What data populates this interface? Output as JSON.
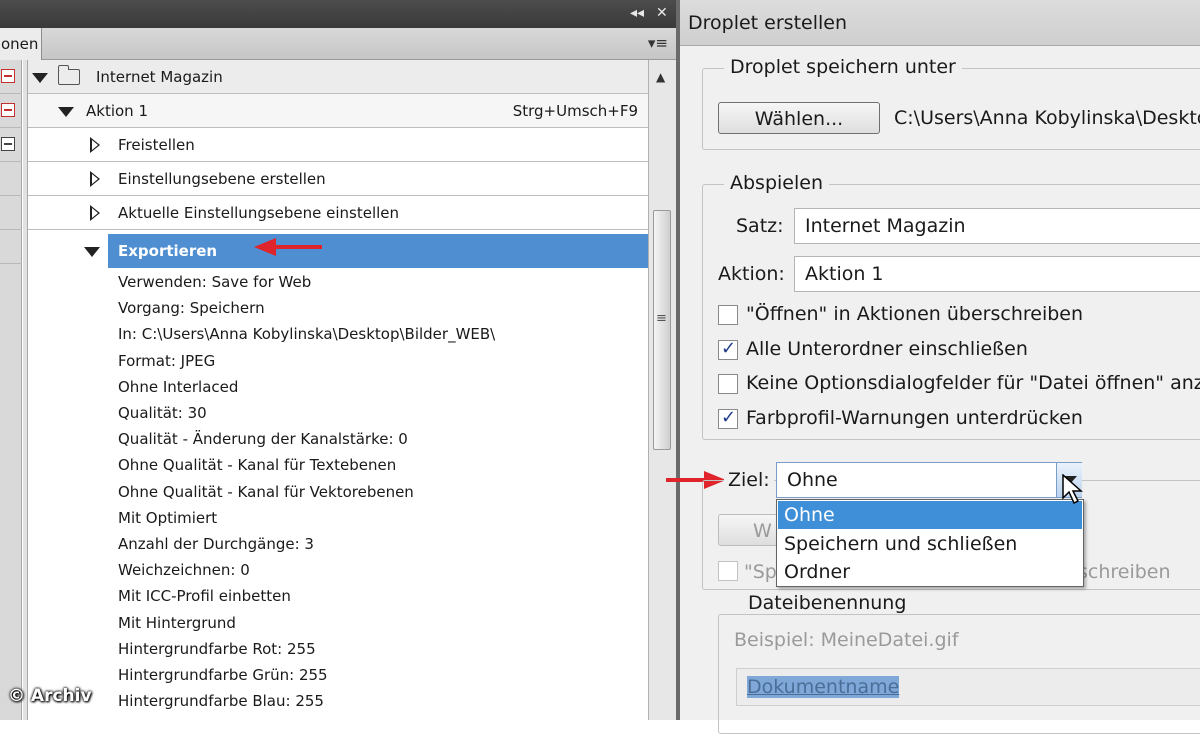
{
  "actions_panel": {
    "tab_label": "onen",
    "set": {
      "name": "Internet Magazin"
    },
    "action": {
      "name": "Aktion 1",
      "shortcut": "Strg+Umsch+F9"
    },
    "steps": [
      {
        "label": "Freistellen"
      },
      {
        "label": "Einstellungsebene erstellen"
      },
      {
        "label": "Aktuelle Einstellungsebene einstellen"
      },
      {
        "label": "Exportieren"
      }
    ],
    "export_details": [
      "Verwenden: Save for Web",
      "Vorgang: Speichern",
      "In: C:\\Users\\Anna Kobylinska\\Desktop\\Bilder_WEB\\",
      "Format: JPEG",
      "Ohne Interlaced",
      "Qualität: 30",
      "Qualität - Änderung der Kanalstärke: 0",
      "Ohne Qualität - Kanal für Textebenen",
      "Ohne Qualität - Kanal für Vektorebenen",
      "Mit Optimiert",
      "Anzahl der Durchgänge: 3",
      "Weichzeichnen: 0",
      "Mit ICC-Profil einbetten",
      "Mit Hintergrund",
      "Hintergrundfarbe Rot: 255",
      "Hintergrundfarbe Grün: 255",
      "Hintergrundfarbe Blau: 255"
    ],
    "watermark": "© Archiv"
  },
  "droplet_dialog": {
    "title": "Droplet erstellen",
    "save_group": {
      "title": "Droplet speichern unter",
      "choose_button": "Wählen...",
      "path": "C:\\Users\\Anna Kobylinska\\Deskto"
    },
    "play_group": {
      "title": "Abspielen",
      "set_label": "Satz:",
      "set_value": "Internet Magazin",
      "action_label": "Aktion:",
      "action_value": "Aktion 1",
      "checkboxes": [
        {
          "label": "\"Öffnen\" in Aktionen überschreiben",
          "checked": false
        },
        {
          "label": "Alle Unterordner einschließen",
          "checked": true
        },
        {
          "label": "Keine Optionsdialogfelder für \"Datei öffnen\" anze",
          "checked": false
        },
        {
          "label": "Farbprofil-Warnungen unterdrücken",
          "checked": true
        }
      ]
    },
    "target": {
      "label": "Ziel:",
      "value": "Ohne",
      "options": [
        "Ohne",
        "Speichern und schließen",
        "Ordner"
      ],
      "hidden_button_fragment": "W",
      "hidden_checkbox_start": "\"Sp",
      "hidden_checkbox_end": "schreiben"
    },
    "naming_group": {
      "title": "Dateibenennung",
      "example": "Beispiel: MeineDatei.gif",
      "field_value": "Dokumentname"
    }
  },
  "colors": {
    "selection": "#4f8fd1",
    "annotation_arrow": "#e0242b",
    "dropdown_highlight": "#3f8ed8"
  }
}
